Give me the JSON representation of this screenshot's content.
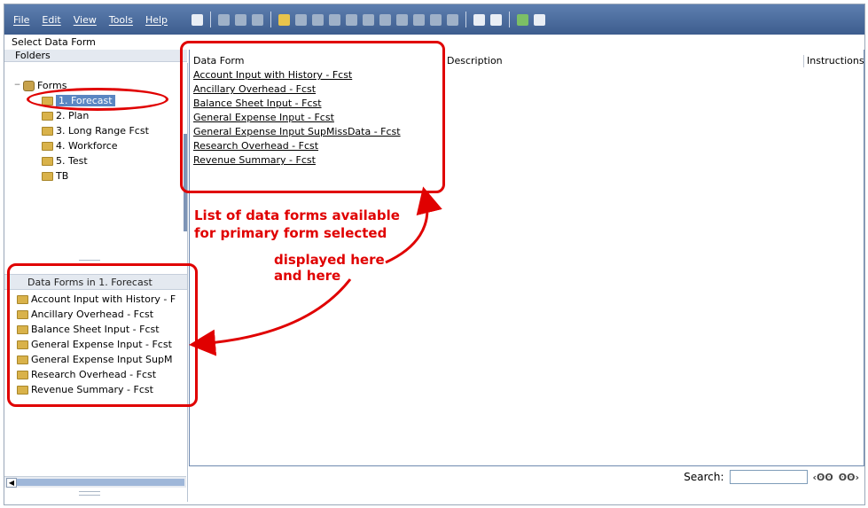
{
  "menu": [
    "File",
    "Edit",
    "View",
    "Tools",
    "Help"
  ],
  "page_title": "Select Data Form",
  "folders_header": "Folders",
  "tree": {
    "root": "Forms",
    "items": [
      "1. Forecast",
      "2. Plan",
      "3. Long Range Fcst",
      "4. Workforce",
      "5. Test",
      "TB"
    ],
    "selected_index": 0
  },
  "data_forms_panel": {
    "header": "Data Forms in 1. Forecast",
    "items": [
      "Account Input with History - F",
      "Ancillary Overhead - Fcst",
      "Balance Sheet Input - Fcst",
      "General Expense Input - Fcst",
      "General Expense Input SupM",
      "Research Overhead - Fcst",
      "Revenue Summary - Fcst"
    ]
  },
  "table": {
    "columns": [
      "Data Form",
      "Description",
      "Instructions"
    ],
    "rows": [
      "Account Input with History - Fcst",
      "Ancillary Overhead - Fcst",
      "Balance Sheet Input - Fcst",
      "General Expense Input - Fcst",
      "General Expense Input SupMissData - Fcst",
      "Research Overhead - Fcst",
      "Revenue Summary - Fcst"
    ]
  },
  "search": {
    "label": "Search:",
    "value": ""
  },
  "annotations": {
    "line1": "List of data forms available",
    "line2": "for primary form selected",
    "line3": "displayed here",
    "line4": "and here",
    "color": "#e00000"
  },
  "colors": {
    "toolbar": "#4a6a9c",
    "selection": "#5a86c2"
  }
}
